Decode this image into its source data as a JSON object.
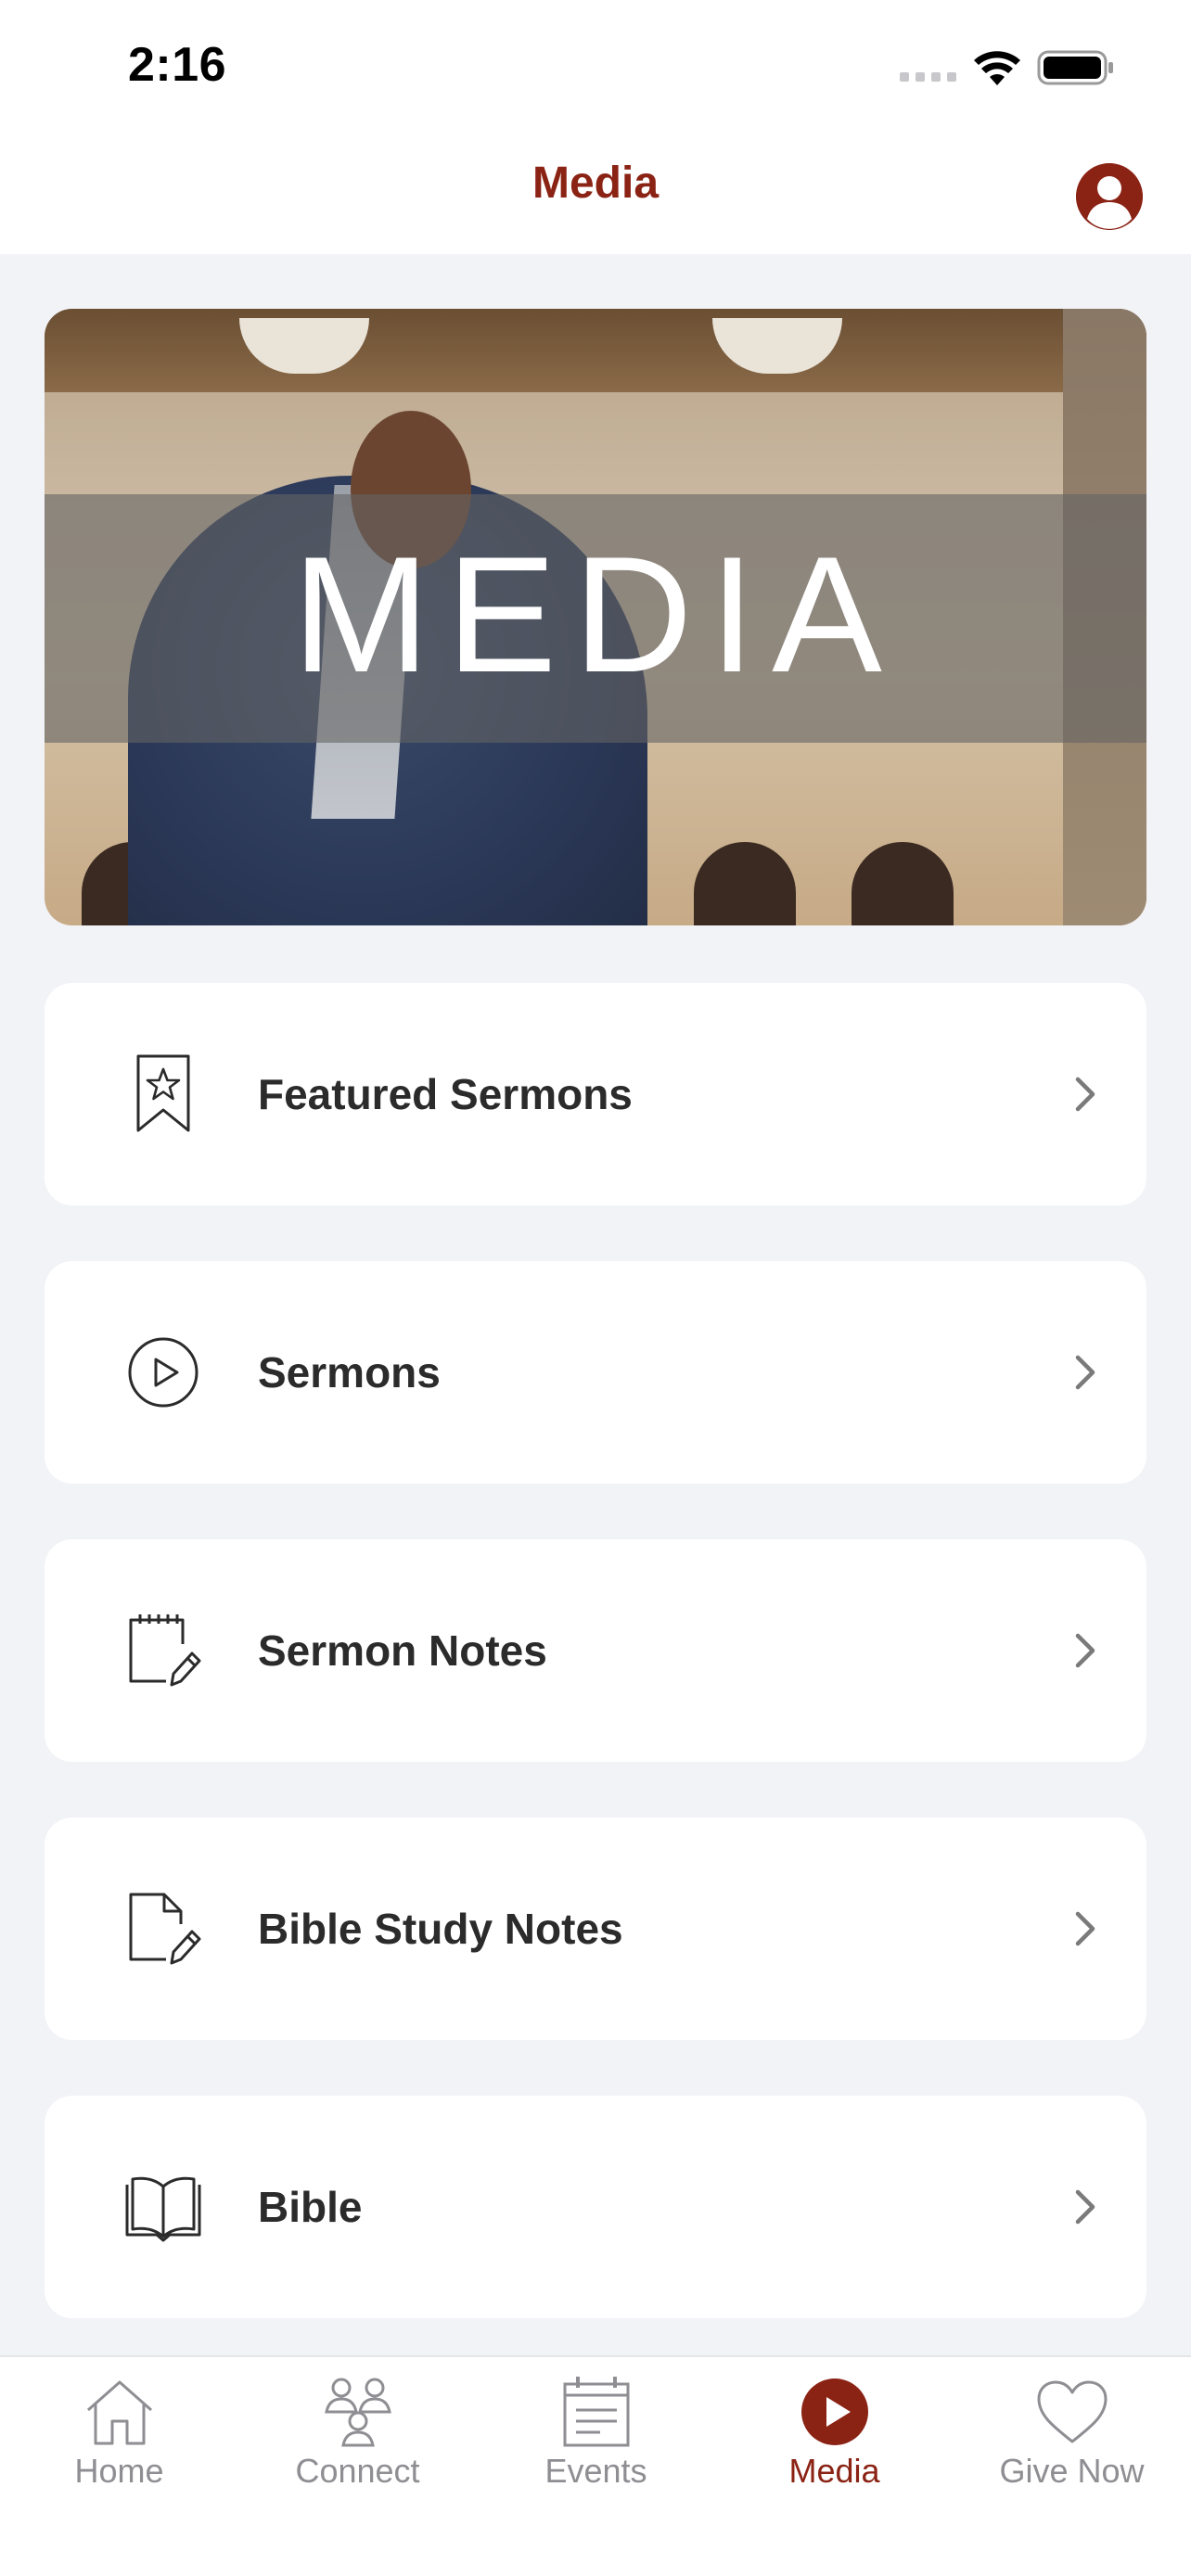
{
  "status_bar": {
    "time": "2:16"
  },
  "header": {
    "title": "Media",
    "profile_icon": "user-circle-icon"
  },
  "hero": {
    "title": "MEDIA"
  },
  "menu": [
    {
      "label": "Featured Sermons",
      "icon": "bookmark-star-icon"
    },
    {
      "label": "Sermons",
      "icon": "play-circle-icon"
    },
    {
      "label": "Sermon Notes",
      "icon": "notepad-pencil-icon"
    },
    {
      "label": "Bible Study Notes",
      "icon": "document-pencil-icon"
    },
    {
      "label": "Bible",
      "icon": "open-book-icon"
    }
  ],
  "tab_bar": {
    "tabs": [
      {
        "label": "Home",
        "icon": "home-icon"
      },
      {
        "label": "Connect",
        "icon": "people-icon"
      },
      {
        "label": "Events",
        "icon": "calendar-icon"
      },
      {
        "label": "Media",
        "icon": "play-circle-filled-icon",
        "active": true
      },
      {
        "label": "Give Now",
        "icon": "heart-icon"
      }
    ]
  },
  "colors": {
    "accent": "#8b2315",
    "background": "#f2f3f7",
    "inactive_tab": "#8e8e93"
  }
}
